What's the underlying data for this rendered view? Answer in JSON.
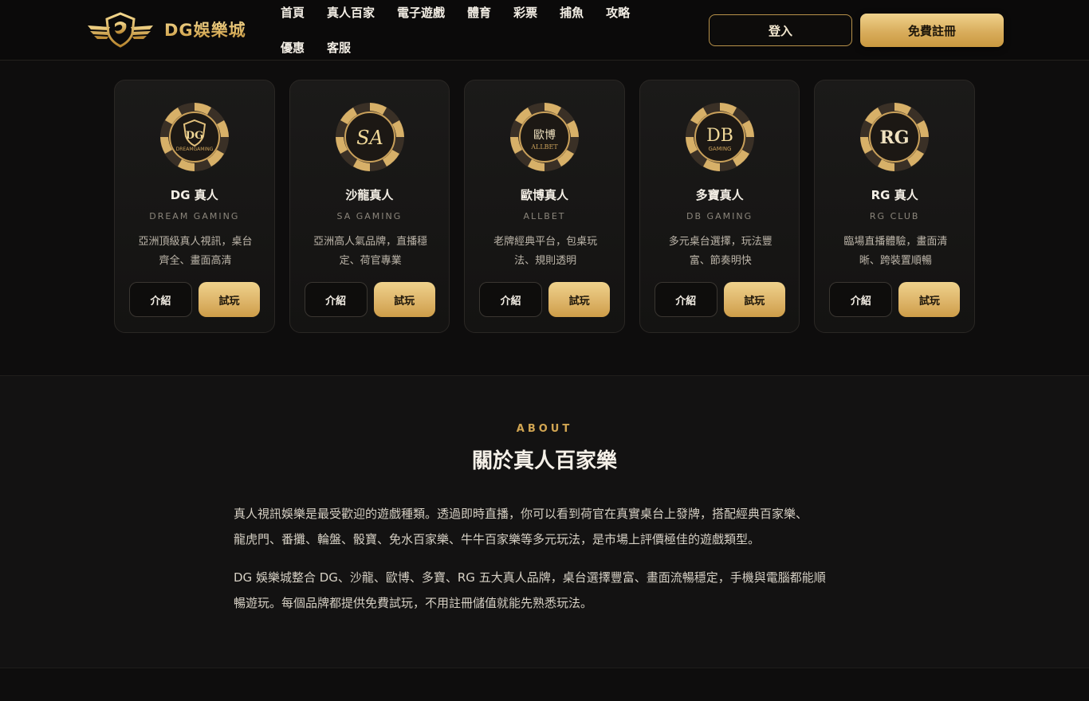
{
  "brand": {
    "name": "DG娛樂城"
  },
  "nav": {
    "items": [
      "首頁",
      "真人百家",
      "電子遊戲",
      "體育",
      "彩票",
      "捕魚",
      "攻略",
      "優惠",
      "客服"
    ]
  },
  "header": {
    "login_label": "登入",
    "register_label": "免費註冊"
  },
  "cards": [
    {
      "chip_text": "DG",
      "chip_sub": "DREAMGAMING",
      "title": "DG 真人",
      "subtitle": "DREAM GAMING",
      "desc_line1": "亞洲頂級真人視訊，桌台",
      "desc_line2": "齊全、畫面高清",
      "intro_label": "介紹",
      "try_label": "試玩"
    },
    {
      "chip_text": "SA",
      "chip_sub": "",
      "title": "沙龍真人",
      "subtitle": "SA GAMING",
      "desc_line1": "亞洲高人氣品牌，直播穩",
      "desc_line2": "定、荷官專業",
      "intro_label": "介紹",
      "try_label": "試玩"
    },
    {
      "chip_text": "歐博",
      "chip_sub": "ALLBET",
      "title": "歐博真人",
      "subtitle": "ALLBET",
      "desc_line1": "老牌經典平台，包桌玩",
      "desc_line2": "法、規則透明",
      "intro_label": "介紹",
      "try_label": "試玩"
    },
    {
      "chip_text": "DB",
      "chip_sub": "GAMING",
      "title": "多寶真人",
      "subtitle": "DB GAMING",
      "desc_line1": "多元桌台選擇，玩法豐",
      "desc_line2": "富、節奏明快",
      "intro_label": "介紹",
      "try_label": "試玩"
    },
    {
      "chip_text": "RG",
      "chip_sub": "",
      "title": "RG 真人",
      "subtitle": "RG CLUB",
      "desc_line1": "臨場直播體驗，畫面清",
      "desc_line2": "晰、跨裝置順暢",
      "intro_label": "介紹",
      "try_label": "試玩"
    }
  ],
  "about": {
    "eyebrow": "ABOUT",
    "title": "關於真人百家樂",
    "p1_line1": "真人視訊娛樂是最受歡迎的遊戲種類。透過即時直播，你可以看到荷官在真實桌台上發牌，搭配經典百家樂、",
    "p1_line2": "龍虎門、番攤、輪盤、骰寶、免水百家樂、牛牛百家樂等多元玩法，是市場上評價極佳的遊戲類型。",
    "p2_line1": "DG 娛樂城整合 DG、沙龍、歐博、多寶、RG 五大真人品牌，桌台選擇豐富、畫面流暢穩定，手機與電腦都能順",
    "p2_line2": "暢遊玩。每個品牌都提供免費試玩，不用註冊儲值就能先熟悉玩法。"
  },
  "colors": {
    "gold": "#d9ad5c",
    "background": "#0e0d0d",
    "card": "#1a1918"
  }
}
